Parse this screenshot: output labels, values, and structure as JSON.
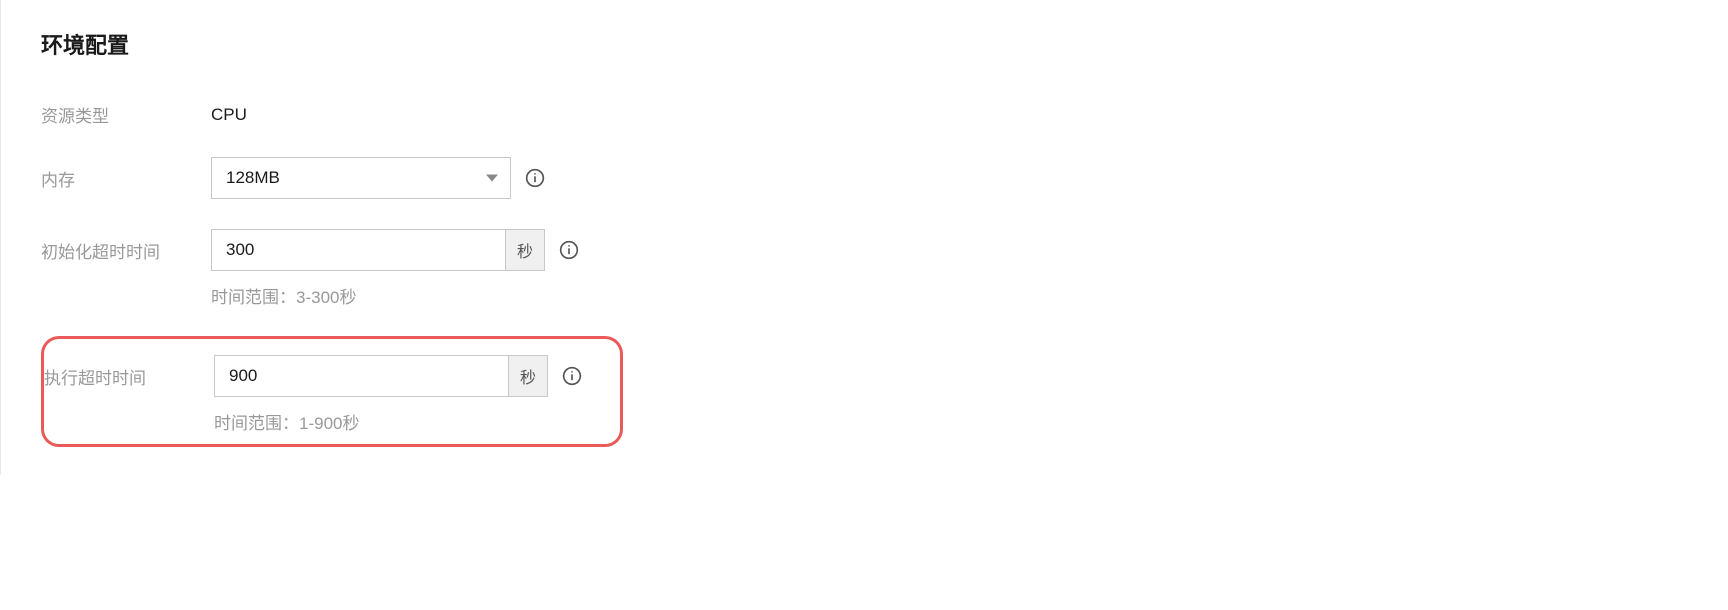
{
  "section": {
    "title": "环境配置"
  },
  "resourceType": {
    "label": "资源类型",
    "value": "CPU"
  },
  "memory": {
    "label": "内存",
    "selected": "128MB"
  },
  "initTimeout": {
    "label": "初始化超时时间",
    "value": "300",
    "unit": "秒",
    "hint": "时间范围：3-300秒"
  },
  "execTimeout": {
    "label": "执行超时时间",
    "value": "900",
    "unit": "秒",
    "hint": "时间范围：1-900秒"
  }
}
